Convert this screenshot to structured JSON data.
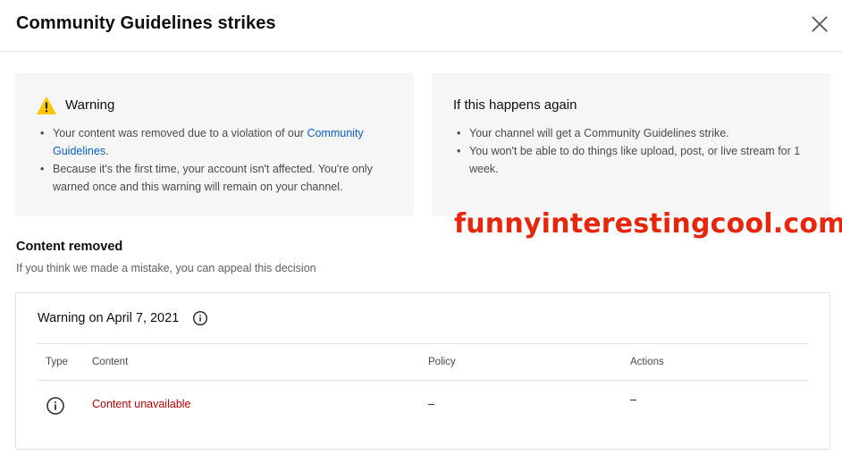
{
  "header": {
    "title": "Community Guidelines strikes"
  },
  "warning_card": {
    "heading": "Warning",
    "bullet1_pre": "Your content was removed due to a violation of our ",
    "bullet1_link": "Community Guidelines",
    "bullet1_post": ".",
    "bullet2": "Because it's the first time, your account isn't affected. You're only warned once and this warning will remain on your channel."
  },
  "again_card": {
    "heading": "If this happens again",
    "bullet1": "Your channel will get a Community Guidelines strike.",
    "bullet2": "You won't be able to do things like upload, post, or live stream for 1 week."
  },
  "watermark": "funnyinterestingcool.com",
  "content_removed": {
    "title": "Content removed",
    "subtitle": "If you think we made a mistake, you can appeal this decision"
  },
  "strike_table": {
    "title": "Warning on April 7, 2021",
    "columns": [
      "Type",
      "Content",
      "Policy",
      "Actions"
    ],
    "rows": [
      {
        "type_icon": "info-icon",
        "content": "Content unavailable",
        "policy": "–",
        "actions": "–"
      }
    ]
  },
  "icons": {
    "close": "close-icon",
    "warning": "warning-triangle-icon",
    "info": "info-icon"
  },
  "colors": {
    "link": "#065fd4",
    "warning_yellow": "#f9c800",
    "error_red": "#c00000",
    "watermark": "#e8260c",
    "card_bg": "#f6f6f6"
  }
}
